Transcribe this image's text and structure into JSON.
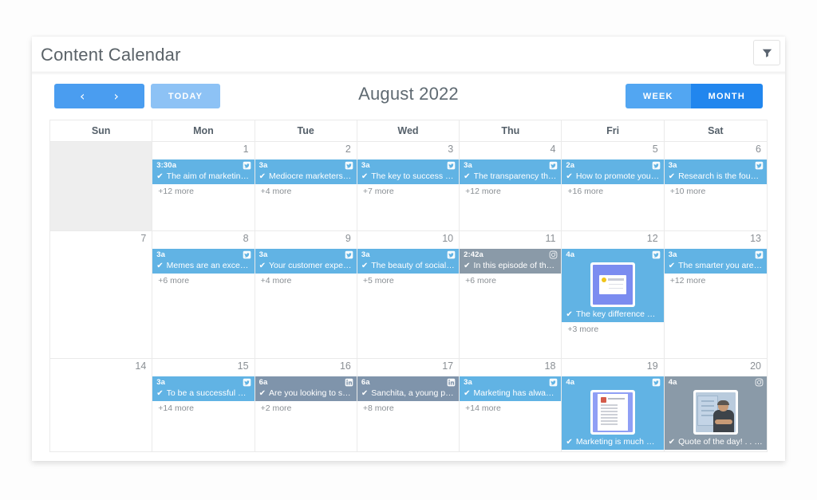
{
  "header": {
    "title": "Content Calendar",
    "filter_icon": "funnel-icon"
  },
  "toolbar": {
    "prev_label": "‹",
    "next_label": "›",
    "today_label": "TODAY",
    "month_label": "August 2022",
    "week_label": "WEEK",
    "month_view_label": "MONTH",
    "active_view": "MONTH"
  },
  "colors": {
    "primary_blue": "#4a9df0",
    "active_blue": "#2186ee",
    "light_blue": "#8dc2f5",
    "event_blue": "#61b3e4",
    "event_slate": "#7f94ab",
    "event_grey": "#8a9aa8",
    "other_month_bg": "#eeeeee",
    "title_grey": "#5a6268"
  },
  "calendar": {
    "day_headers": [
      "Sun",
      "Mon",
      "Tue",
      "Wed",
      "Thu",
      "Fri",
      "Sat"
    ],
    "weeks": [
      {
        "days": [
          {
            "num": "",
            "other_month": true,
            "events": [],
            "more": ""
          },
          {
            "num": "1",
            "events": [
              {
                "time": "3:30a",
                "icon": "twitter-icon",
                "color": "blue",
                "title": "The aim of marketing i…"
              }
            ],
            "more": "+12 more"
          },
          {
            "num": "2",
            "events": [
              {
                "time": "3a",
                "icon": "twitter-icon",
                "color": "blue",
                "title": "Mediocre marketers s…"
              }
            ],
            "more": "+4 more"
          },
          {
            "num": "3",
            "events": [
              {
                "time": "3a",
                "icon": "twitter-icon",
                "color": "blue",
                "title": "The key to success in …"
              }
            ],
            "more": "+7 more"
          },
          {
            "num": "4",
            "events": [
              {
                "time": "3a",
                "icon": "twitter-icon",
                "color": "blue",
                "title": "The transparency that…"
              }
            ],
            "more": "+12 more"
          },
          {
            "num": "5",
            "events": [
              {
                "time": "2a",
                "icon": "twitter-icon",
                "color": "blue",
                "title": "How to promote your …"
              }
            ],
            "more": "+16 more"
          },
          {
            "num": "6",
            "events": [
              {
                "time": "3a",
                "icon": "twitter-icon",
                "color": "blue",
                "title": "Research is the found…"
              }
            ],
            "more": "+10 more"
          }
        ]
      },
      {
        "days": [
          {
            "num": "7",
            "events": [],
            "more": ""
          },
          {
            "num": "8",
            "events": [
              {
                "time": "3a",
                "icon": "twitter-icon",
                "color": "blue",
                "title": "Memes are an excelle…"
              }
            ],
            "more": "+6 more"
          },
          {
            "num": "9",
            "events": [
              {
                "time": "3a",
                "icon": "twitter-icon",
                "color": "blue",
                "title": "Your customer experi…"
              }
            ],
            "more": "+4 more"
          },
          {
            "num": "10",
            "events": [
              {
                "time": "3a",
                "icon": "twitter-icon",
                "color": "blue",
                "title": "The beauty of social …"
              }
            ],
            "more": "+5 more"
          },
          {
            "num": "11",
            "events": [
              {
                "time": "2:42a",
                "icon": "instagram-icon",
                "color": "grey",
                "title": "In this episode of the …"
              }
            ],
            "more": "+6 more"
          },
          {
            "num": "12",
            "events": [
              {
                "time": "4a",
                "icon": "twitter-icon",
                "color": "blue",
                "thumb": "thumb-a",
                "title": "The key difference bet…"
              }
            ],
            "more": "+3 more"
          },
          {
            "num": "13",
            "events": [
              {
                "time": "3a",
                "icon": "twitter-icon",
                "color": "blue",
                "title": "The smarter you are a…"
              }
            ],
            "more": "+12 more"
          }
        ]
      },
      {
        "days": [
          {
            "num": "14",
            "events": [],
            "more": ""
          },
          {
            "num": "15",
            "events": [
              {
                "time": "3a",
                "icon": "twitter-icon",
                "color": "blue",
                "title": "To be a successful sto…"
              }
            ],
            "more": "+14 more"
          },
          {
            "num": "16",
            "events": [
              {
                "time": "6a",
                "icon": "linkedin-icon",
                "color": "slate",
                "title": "Are you looking to sta…"
              }
            ],
            "more": "+2 more"
          },
          {
            "num": "17",
            "events": [
              {
                "time": "6a",
                "icon": "linkedin-icon",
                "color": "slate",
                "title": "Sanchita, a young prof…"
              }
            ],
            "more": "+8 more"
          },
          {
            "num": "18",
            "events": [
              {
                "time": "3a",
                "icon": "twitter-icon",
                "color": "blue",
                "title": "Marketing has always …"
              }
            ],
            "more": "+14 more"
          },
          {
            "num": "19",
            "events": [
              {
                "time": "4a",
                "icon": "twitter-icon",
                "color": "blue",
                "thumb": "thumb-b",
                "title": "Marketing is much mo…"
              }
            ],
            "more": ""
          },
          {
            "num": "20",
            "events": [
              {
                "time": "4a",
                "icon": "instagram-icon",
                "color": "grey",
                "thumb": "thumb-c",
                "title": "Quote of the day! . . . …"
              }
            ],
            "more": ""
          }
        ]
      }
    ]
  }
}
